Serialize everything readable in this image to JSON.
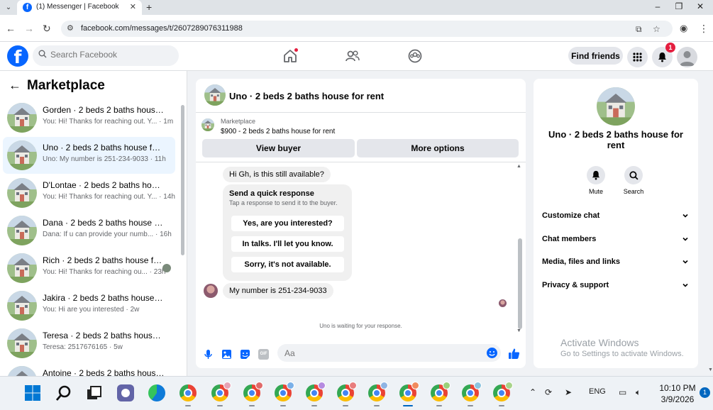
{
  "browser": {
    "tab_title": "(1) Messenger | Facebook",
    "tab_favicon": "f",
    "url": "facebook.com/messages/t/2607289076311988",
    "icons": [
      "tab-search-icon",
      "back-icon",
      "forward-icon",
      "reload-icon",
      "site-info-icon",
      "install-app-icon",
      "star-icon",
      "profile-icon",
      "menu-icon",
      "minimize-icon",
      "maximize-icon",
      "close-icon"
    ]
  },
  "fb_header": {
    "logo": "f",
    "search_placeholder": "Search Facebook",
    "find_friends": "Find friends",
    "notification_count": "1",
    "nav_icons": [
      "home-icon",
      "friends-icon",
      "groups-icon"
    ]
  },
  "left_panel": {
    "title": "Marketplace",
    "back_arrow": "←",
    "conversations": [
      {
        "name": "Gorden · 2 beds 2 baths house for rent",
        "preview": "You: Hi! Thanks for reaching out. Y... · 1m",
        "active": false
      },
      {
        "name": "Uno · 2 beds 2 baths house for rent",
        "preview": "Uno: My number is 251-234-9033 · 11h",
        "active": true
      },
      {
        "name": "D'Lontae · 2 beds 2 baths house for rent",
        "preview": "You: Hi! Thanks for reaching out. Y... · 14h",
        "active": false
      },
      {
        "name": "Dana · 2 beds 2 baths house for rent",
        "preview": "Dana: If u can provide your numb... · 16h",
        "active": false
      },
      {
        "name": "Rich · 2 beds 2 baths house for rent",
        "preview": "You: Hi! Thanks for reaching ou... · 23h",
        "active": false
      },
      {
        "name": "Jakira · 2 beds 2 baths house for rent",
        "preview": "You: Hi are you interested · 2w",
        "active": false
      },
      {
        "name": "Teresa · 2 beds 2 baths house for rent",
        "preview": "Teresa: 2517676165 · 5w",
        "active": false
      },
      {
        "name": "Antoine · 2 beds 2 baths house for rent",
        "preview": "",
        "active": false
      }
    ]
  },
  "chat": {
    "title": "Uno · 2 beds 2 baths house for rent",
    "marketplace_label": "Marketplace",
    "listing": "$900 - 2 beds 2 baths house for rent",
    "view_buyer": "View buyer",
    "more_options": "More options",
    "msg1": "Hi Gh, is this still available?",
    "quick_title": "Send a quick response",
    "quick_sub": "Tap a response to send it to the buyer.",
    "quick_options": [
      "Yes, are you interested?",
      "In talks. I'll let you know.",
      "Sorry, it's not available."
    ],
    "msg2": "My number is 251-234-9033",
    "waiting": "Uno is waiting for your response.",
    "composer_placeholder": "Aa",
    "gif_label": "GIF"
  },
  "info_panel": {
    "name": "Uno · 2 beds 2 baths house for rent",
    "mute": "Mute",
    "search": "Search",
    "sections": [
      "Customize chat",
      "Chat members",
      "Media, files and links",
      "Privacy & support"
    ]
  },
  "watermark": {
    "line1": "Activate Windows",
    "line2": "Go to Settings to activate Windows."
  },
  "taskbar": {
    "lang": "ENG",
    "time": "10:10 PM",
    "date": "3/9/2026",
    "notification_count": "1"
  },
  "colors": {
    "brand_blue": "#0866ff",
    "badge_red": "#e41e3f",
    "active_conv": "#ebf5ff",
    "info_purple": "#a033ff"
  }
}
